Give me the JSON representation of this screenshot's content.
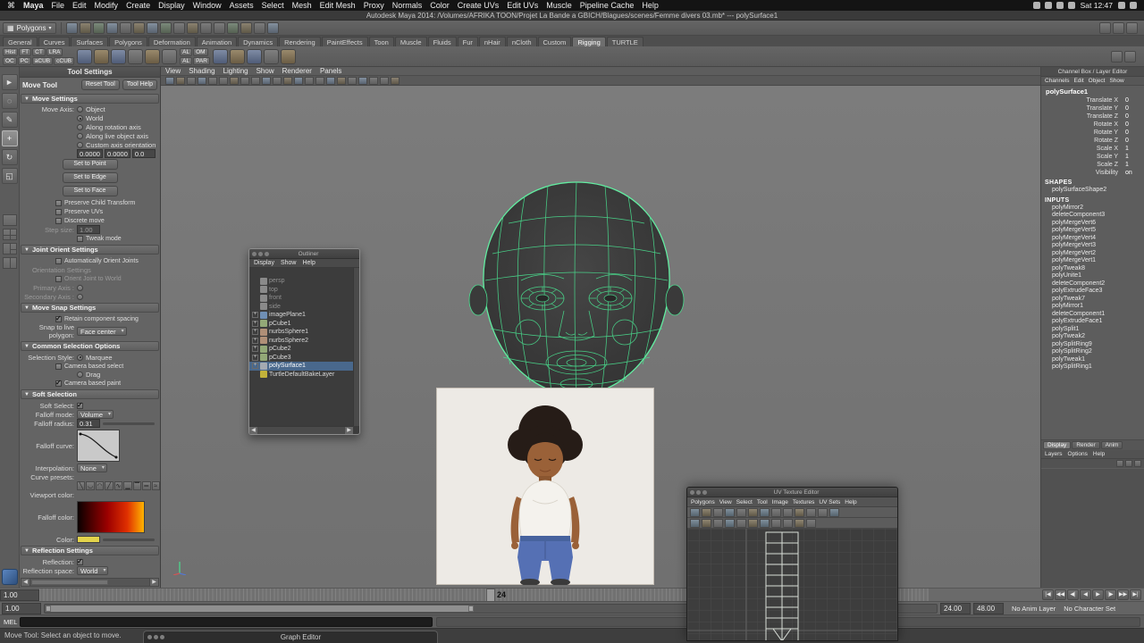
{
  "colors": {
    "wireframe_green": "#4adf8f",
    "selection_blue": "#49688c",
    "falloff_yellow": "#e3d34b"
  },
  "menubar": {
    "apple_glyph": "⌘",
    "items": [
      "Maya",
      "File",
      "Edit",
      "Modify",
      "Create",
      "Display",
      "Window",
      "Assets",
      "Select",
      "Mesh",
      "Edit Mesh",
      "Proxy",
      "Normals",
      "Color",
      "Create UVs",
      "Edit UVs",
      "Muscle",
      "Pipeline Cache",
      "Help"
    ],
    "status_icons": [
      "displays",
      "bluetooth",
      "wifi",
      "battery"
    ],
    "clock": "Sat 12:47",
    "right_icons": [
      "spotlight",
      "notification-center"
    ]
  },
  "titlebar": {
    "title": "Autodesk Maya 2014: /Volumes/AFRIKA TOON/Projet La Bande a GBICH/Blagues/scenes/Femme divers 03.mb* --- polySurface1"
  },
  "statusline": {
    "selection_mask": "Polygons",
    "icons": [
      "select-hierarchy",
      "select-object",
      "select-component",
      "snap-to-grid",
      "snap-to-curve",
      "snap-to-point",
      "snap-to-view-plane",
      "make-live",
      "construction-history",
      "render-view",
      "quick-render",
      "ipr-render",
      "render-settings",
      "paint-effects-panel",
      "hypershade",
      "script-editor"
    ],
    "right_icons": [
      "show-manipulators",
      "channel-box-toggle",
      "attribute-editor-toggle"
    ]
  },
  "shelf": {
    "tabs": [
      {
        "label": "General"
      },
      {
        "label": "Curves"
      },
      {
        "label": "Surfaces"
      },
      {
        "label": "Polygons"
      },
      {
        "label": "Deformation"
      },
      {
        "label": "Animation"
      },
      {
        "label": "Dynamics"
      },
      {
        "label": "Rendering"
      },
      {
        "label": "PaintEffects"
      },
      {
        "label": "Toon"
      },
      {
        "label": "Muscle"
      },
      {
        "label": "Fluids"
      },
      {
        "label": "Fur"
      },
      {
        "label": "nHair"
      },
      {
        "label": "nCloth"
      },
      {
        "label": "Custom"
      },
      {
        "label": "Rigging",
        "selected": true
      },
      {
        "label": "TURTLE"
      }
    ],
    "mini_buttons_1": [
      "Hist",
      "FT",
      "CT",
      "LRA"
    ],
    "mini_buttons_2": [
      "OC",
      "PC",
      "aCUB",
      "cCUB"
    ],
    "mini_buttons_3": [
      "AL",
      "OM"
    ],
    "mini_buttons_4": [
      "AL",
      "PAR"
    ],
    "icons_a": [
      "joint-tool",
      "ik-handle",
      "bind-skin",
      "paint-skin-weights",
      "blend-shape",
      "cluster"
    ],
    "icons_b": [
      "parent-constraint",
      "point-constraint",
      "orient-constraint",
      "aim-constraint",
      "locator"
    ],
    "right_icons": [
      "shelf-menu",
      "shelf-editor"
    ]
  },
  "toolbox": {
    "tools": [
      {
        "name": "select-tool",
        "glyph": "►"
      },
      {
        "name": "lasso-tool",
        "glyph": "◌"
      },
      {
        "name": "paint-select-tool",
        "glyph": "✎"
      },
      {
        "name": "move-tool",
        "glyph": "+",
        "selected": true
      },
      {
        "name": "rotate-tool",
        "glyph": "↻"
      },
      {
        "name": "scale-tool",
        "glyph": "◱"
      }
    ],
    "layouts": [
      {
        "icon": "single"
      },
      {
        "icon": "four"
      },
      {
        "icon": "three"
      },
      {
        "icon": "two"
      }
    ]
  },
  "tool_settings": {
    "panel_title": "Tool Settings",
    "tool_name": "Move Tool",
    "reset_button": "Reset Tool",
    "help_button": "Tool Help",
    "move_settings": {
      "title": "Move Settings",
      "axis_label": "Move Axis:",
      "axis_options": [
        {
          "label": "Object"
        },
        {
          "label": "World",
          "selected": true
        },
        {
          "label": "Along rotation axis"
        },
        {
          "label": "Along live object axis"
        },
        {
          "label": "Custom axis orientation"
        }
      ],
      "fields": [
        "0.0000",
        "0.0000",
        "0.0"
      ],
      "set_buttons": [
        "Set to Point",
        "Set to Edge",
        "Set to Face"
      ],
      "checkboxes": [
        {
          "label": "Preserve Child Transform"
        },
        {
          "label": "Preserve UVs"
        },
        {
          "label": "Discrete move"
        }
      ],
      "step_size_label": "Step size:",
      "step_size_value": "1.00",
      "tweak_label": "Tweak mode"
    },
    "joint_orient": {
      "title": "Joint Orient Settings",
      "auto_label": "Automatically Orient Joints",
      "orientation_label": "Orientation Settings",
      "world_label": "Orient Joint to World",
      "primary_label": "Primary Axis :",
      "secondary_label": "Secondary Axis :"
    },
    "move_snap": {
      "title": "Move Snap Settings",
      "retain_label": "Retain component spacing",
      "retain_checked": true,
      "snap_label": "Snap to live polygon:",
      "snap_value": "Face center"
    },
    "selection": {
      "title": "Common Selection Options",
      "style_label": "Selection Style:",
      "style_value": "Marquee",
      "camera_select_label": "Camera based select",
      "drag_label": "Drag",
      "camera_paint_label": "Camera based paint",
      "camera_paint_checked": true
    },
    "soft": {
      "title": "Soft Selection",
      "soft_select_label": "Soft Select:",
      "soft_select_checked": true,
      "falloff_mode_label": "Falloff mode:",
      "falloff_mode_value": "Volume",
      "radius_label": "Falloff radius:",
      "radius_value": "0.31",
      "curve_label": "Falloff curve:",
      "interp_label": "Interpolation:",
      "interp_value": "None",
      "presets_label": "Curve presets:",
      "presets": [
        "╲",
        "◡",
        "◠",
        "╱",
        "∿",
        "▁",
        "▔",
        "═",
        "≈"
      ],
      "viewport_color_label": "Viewport color:",
      "falloff_color_label": "Falloff color:",
      "color_label": "Color:"
    },
    "reflection": {
      "title": "Reflection Settings",
      "label": "Reflection:",
      "checked": true,
      "space_label": "Reflection space:",
      "space_value": "World"
    }
  },
  "viewport": {
    "menus": [
      "View",
      "Shading",
      "Lighting",
      "Show",
      "Renderer",
      "Panels"
    ],
    "icons": [
      "select-camera",
      "lock-camera",
      "camera-attributes",
      "bookmarks",
      "image-plane",
      "wireframe",
      "smooth-shade-all",
      "flat-shade-all",
      "bounding-box",
      "textured",
      "use-default-material",
      "two-sided-lighting",
      "use-all-lights",
      "shadows",
      "screen-space-ao",
      "motion-blur",
      "multisampling",
      "xray",
      "xray-joints",
      "exposure",
      "gamma",
      "isolate-select"
    ]
  },
  "outliner": {
    "title": "Outliner",
    "menus": [
      "Display",
      "Show",
      "Help"
    ],
    "items": [
      {
        "name": "persp",
        "icon": "camera",
        "grayed": true
      },
      {
        "name": "top",
        "icon": "camera",
        "grayed": true
      },
      {
        "name": "front",
        "icon": "camera",
        "grayed": true
      },
      {
        "name": "side",
        "icon": "camera",
        "grayed": true
      },
      {
        "name": "imagePlane1",
        "icon": "plane",
        "exp": true
      },
      {
        "name": "pCube1",
        "icon": "cube",
        "exp": true
      },
      {
        "name": "nurbsSphere1",
        "icon": "sphere",
        "exp": true
      },
      {
        "name": "nurbsSphere2",
        "icon": "sphere",
        "exp": true
      },
      {
        "name": "pCube2",
        "icon": "cube",
        "exp": true
      },
      {
        "name": "pCube3",
        "icon": "cube",
        "exp": true
      },
      {
        "name": "polySurface1",
        "icon": "poly",
        "exp": true,
        "selected": true
      },
      {
        "name": "TurtleDefaultBakeLayer",
        "icon": "layer"
      }
    ]
  },
  "uv_editor": {
    "title": "UV Texture Editor",
    "menus": [
      "Polygons",
      "View",
      "Select",
      "Tool",
      "Image",
      "Textures",
      "UV Sets",
      "Help"
    ],
    "icons_row1": [
      "flip-u",
      "flip-v",
      "rotate-uv-ccw",
      "rotate-uv-cw",
      "cut-uv-edges",
      "split-uvs",
      "sew-uv-edges",
      "move-and-sew",
      "layout-uvs",
      "grid-uvs",
      "align-uvs",
      "snap-to-grid",
      "pixel-snap"
    ],
    "icons_row2": [
      "display-image",
      "dim-image",
      "view-grid",
      "pixel-ratio",
      "shaded-uvs",
      "texture-borders",
      "display-labels",
      "image-range",
      "use-image-ratio",
      "uv-snapshot",
      "refresh-image"
    ]
  },
  "channel_box": {
    "header": "Channel Box / Layer Editor",
    "menus": [
      "Channels",
      "Edit",
      "Object",
      "Show"
    ],
    "object_name": "polySurface1",
    "attributes": [
      {
        "label": "Translate X",
        "value": "0"
      },
      {
        "label": "Translate Y",
        "value": "0"
      },
      {
        "label": "Translate Z",
        "value": "0"
      },
      {
        "label": "Rotate X",
        "value": "0"
      },
      {
        "label": "Rotate Y",
        "value": "0"
      },
      {
        "label": "Rotate Z",
        "value": "0"
      },
      {
        "label": "Scale X",
        "value": "1"
      },
      {
        "label": "Scale Y",
        "value": "1"
      },
      {
        "label": "Scale Z",
        "value": "1"
      },
      {
        "label": "Visibility",
        "value": "on"
      }
    ],
    "shapes_header": "SHAPES",
    "shape_name": "polySurfaceShape2",
    "inputs_header": "INPUTS",
    "inputs": [
      "polyMirror2",
      "deleteComponent3",
      "polyMergeVert6",
      "polyMergeVert5",
      "polyMergeVert4",
      "polyMergeVert3",
      "polyMergeVert2",
      "polyMergeVert1",
      "polyTweak8",
      "polyUnite1",
      "deleteComponent2",
      "polyExtrudeFace3",
      "polyTweak7",
      "polyMirror1",
      "deleteComponent1",
      "polyExtrudeFace1",
      "polySplit1",
      "polyTweak2",
      "polySplitRing9",
      "polySplitRing2",
      "polyTweak1",
      "polySplitRing1"
    ],
    "layer_tabs": [
      {
        "label": "Display",
        "selected": true
      },
      {
        "label": "Render"
      },
      {
        "label": "Anim"
      }
    ],
    "layer_menus": [
      "Layers",
      "Options",
      "Help"
    ],
    "layer_icons": [
      "layer-options",
      "new-empty-layer",
      "new-layer-from-selected"
    ]
  },
  "timeline": {
    "time_start_field": "1.00",
    "current_frame": "24",
    "range_start_field": "1.00",
    "playback_end_field": "24.00",
    "anim_end_field": "48.00",
    "anim_layer": "No Anim Layer",
    "character_set": "No Character Set",
    "playback_icons": [
      "|◀",
      "◀◀",
      "◀|",
      "◀",
      "▶",
      "|▶",
      "▶▶",
      "▶|"
    ]
  },
  "command_line": {
    "label": "MEL",
    "value": ""
  },
  "help_line": {
    "text": "Move Tool: Select an object to move."
  },
  "graph_editor": {
    "title": "Graph Editor"
  }
}
